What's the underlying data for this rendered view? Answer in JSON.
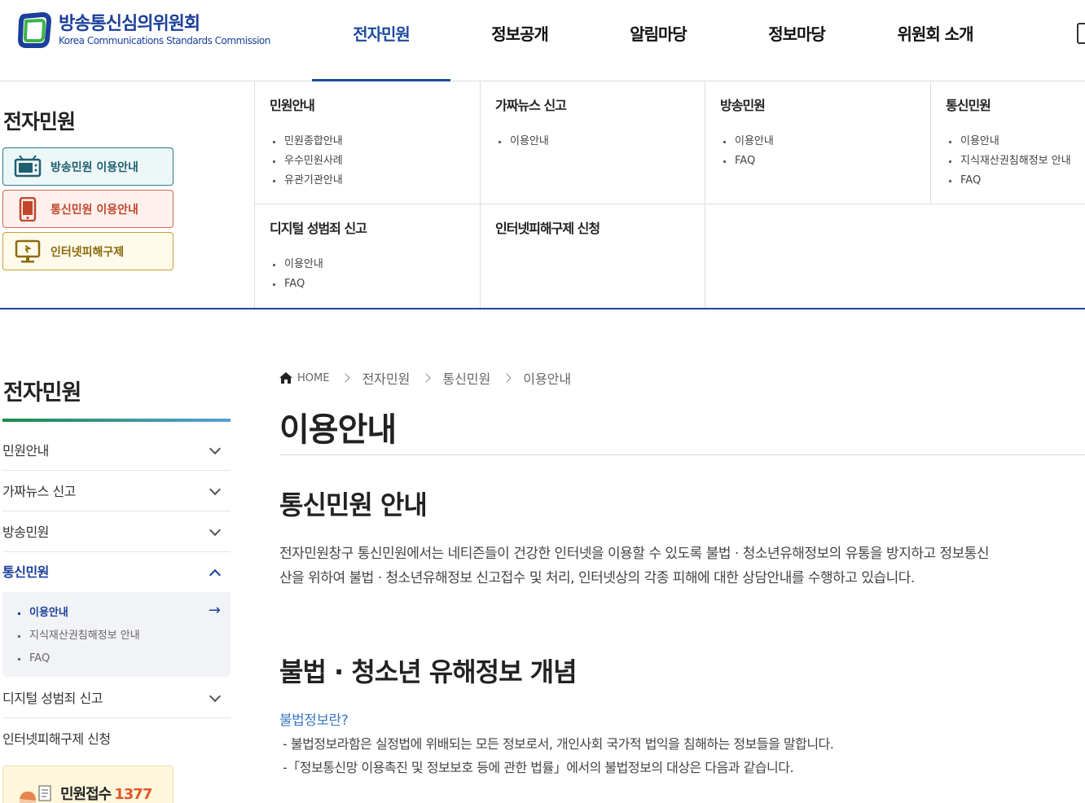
{
  "header": {
    "logo_ko": "방송통신심의위원회",
    "logo_en": "Korea Communications Standards Commission",
    "nav": [
      "전자민원",
      "정보공개",
      "알림마당",
      "정보마당",
      "위원회 소개"
    ]
  },
  "mega": {
    "title": "전자민원",
    "quick": [
      "방송민원 이용안내",
      "통신민원 이용안내",
      "인터넷피해구제"
    ],
    "columns": [
      {
        "title": "민원안내",
        "items": [
          "민원종합안내",
          "우수민원사례",
          "유관기관안내"
        ]
      },
      {
        "title": "가짜뉴스 신고",
        "items": [
          "이용안내"
        ]
      },
      {
        "title": "방송민원",
        "items": [
          "이용안내",
          "FAQ"
        ]
      },
      {
        "title": "통신민원",
        "items": [
          "이용안내",
          "지식재산권침해정보 안내",
          "FAQ"
        ]
      },
      {
        "title": "디지털 성범죄 신고",
        "items": [
          "이용안내",
          "FAQ"
        ]
      },
      {
        "title": "인터넷피해구제 신청",
        "items": []
      }
    ]
  },
  "lnb": {
    "title": "전자민원",
    "items": [
      "민원안내",
      "가짜뉴스 신고",
      "방송민원",
      "통신민원",
      "디지털 성범죄 신고",
      "인터넷피해구제 신청"
    ],
    "sub": [
      "이용안내",
      "지식재산권침해정보 안내",
      "FAQ"
    ],
    "counter_label": "민원접수",
    "counter_value": "1377"
  },
  "content": {
    "breadcrumb": [
      "HOME",
      "전자민원",
      "통신민원",
      "이용안내"
    ],
    "title": "이용안내",
    "h2a": "통신민원 안내",
    "para1": "전자민원창구 통신민원에서는 네티즌들이 건강한 인터넷을 이용할 수 있도록 불법 · 청소년유해정보의 유통을 방지하고 정보통신",
    "para2": "산을 위하여 불법 · 청소년유해정보 신고접수 및 처리, 인터넷상의 각종 피해에 대한 상담안내를 수행하고 있습니다.",
    "h2b": "불법 · 청소년 유해정보 개념",
    "sub_link": "불법정보란?",
    "dash1": "-  불법정보라함은 실정법에 위배되는 모든 정보로서, 개인사회 국가적 법익을 침해하는 정보들을 말합니다.",
    "dash2": "-「정보통신망 이용촉진 및 정보보호 등에 관한 법률」에서의 불법정보의 대상은 다음과 같습니다."
  },
  "colors": {
    "brand": "#1b3f9a",
    "accent_link": "#3a78c2",
    "counter": "#e0582a"
  }
}
